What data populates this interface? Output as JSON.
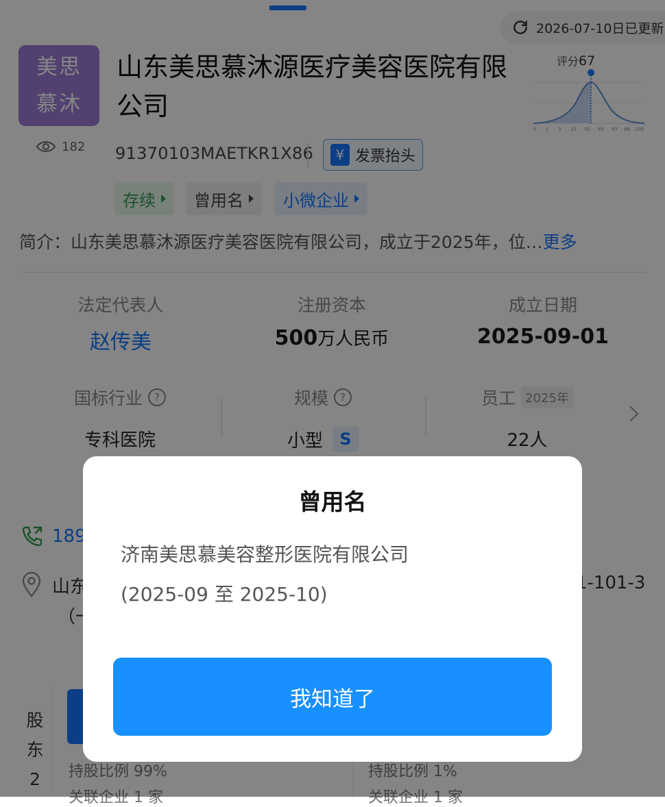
{
  "update": {
    "text": "2026-07-10日已更新"
  },
  "company": {
    "logo_line1": "美思",
    "logo_line2": "慕沐",
    "views": "182",
    "name_line1": "山东美思慕沐源医疗美容医院有限",
    "name_line2": "公司",
    "credit_code": "91370103MAETKR1X86",
    "invoice_label": "发票抬头",
    "invoice_icon_glyph": "¥"
  },
  "score": {
    "label": "评分",
    "value": "67",
    "ticks": [
      "0",
      "1",
      "3",
      "15",
      "50",
      "85",
      "97",
      "99",
      "100"
    ]
  },
  "tags": [
    {
      "label": "存续"
    },
    {
      "label": "曾用名"
    },
    {
      "label": "小微企业"
    }
  ],
  "intro": {
    "text": "简介：山东美思慕沐源医疗美容医院有限公司，成立于2025年，位…",
    "more": "更多"
  },
  "metrics": {
    "legal_rep_label": "法定代表人",
    "legal_rep_value": "赵传美",
    "capital_label": "注册资本",
    "capital_number": "500",
    "capital_unit": "万人民币",
    "founded_label": "成立日期",
    "founded_value": "2025-09-01"
  },
  "metrics2": {
    "industry_label": "国标行业",
    "industry_value": "专科医院",
    "scale_label": "规模",
    "scale_value": "小型",
    "scale_badge": "S",
    "staff_label": "员工",
    "staff_year": "2025年",
    "staff_value": "22人",
    "help_glyph": "?"
  },
  "contact": {
    "phone_partial": "189",
    "address_start": "山东",
    "address_tail": "1-101-3",
    "address_line2": "（一"
  },
  "shareholders": {
    "side_label": [
      "股",
      "东",
      "2"
    ],
    "left_pct": "持股比例 99%",
    "left_rel": "关联企业 1 家",
    "right_pct": "持股比例 1%",
    "right_rel": "关联企业 1 家"
  },
  "modal": {
    "title": "曾用名",
    "former_name": "济南美思慕美容整形医院有限公司",
    "period": "(2025-09 至 2025-10)",
    "ok_label": "我知道了"
  },
  "colors": {
    "accent": "#1677ff",
    "logo_bg": "#9c7cd6",
    "status_green": "#2e9e4f",
    "overlay": "rgba(0,0,0,0.48)"
  }
}
